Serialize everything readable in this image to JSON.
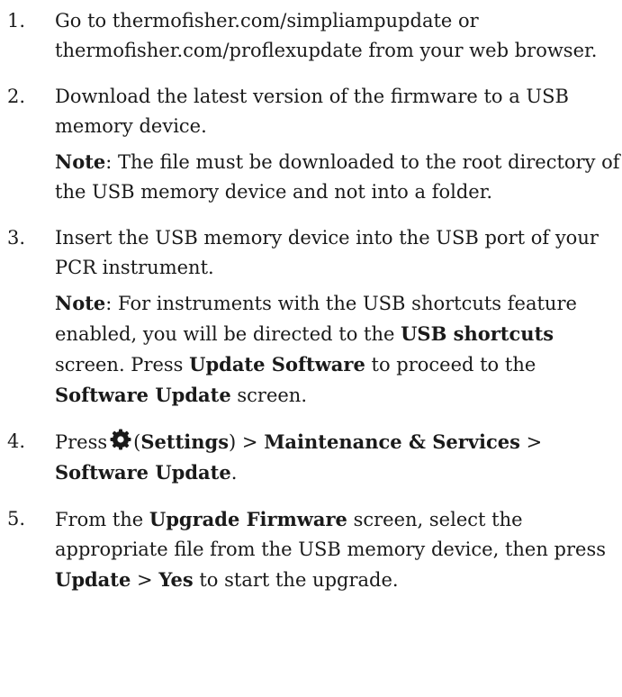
{
  "steps": [
    {
      "num": "1.",
      "text": "Go to thermofisher.com/simpliampupdate  or thermofisher.com/proflexupdate from your web browser."
    },
    {
      "num": "2.",
      "text": "Download the latest version of the firmware to a USB memory device.",
      "note_label": "Note",
      "note_text": ": The file must be downloaded to the root directory of the USB memory device and not into a folder."
    },
    {
      "num": "3.",
      "text": "Insert the USB memory device into the USB port of your PCR instrument.",
      "note_label": "Note",
      "note_a": ": For instruments with the USB shortcuts feature enabled, you will be directed to the ",
      "note_b": "USB shortcuts",
      "note_c": " screen. Press ",
      "note_d": "Update Software",
      "note_e": " to proceed to the ",
      "note_f": "Software Update",
      "note_g": " screen."
    },
    {
      "num": "4.",
      "press": "Press",
      "icon": "settings-gear-icon",
      "open_paren": "(",
      "settings": "Settings",
      "close_sep": ") > ",
      "maintenance": "Maintenance & Services",
      "sep": " > ",
      "software_update": "Software Update",
      "period": "."
    },
    {
      "num": "5.",
      "a": "From the ",
      "upgrade": "Upgrade Firmware",
      "b": " screen, select the appropriate file from the USB memory device, then press ",
      "update": "Update",
      "c": " > ",
      "yes": "Yes",
      "d": " to start the upgrade."
    }
  ]
}
